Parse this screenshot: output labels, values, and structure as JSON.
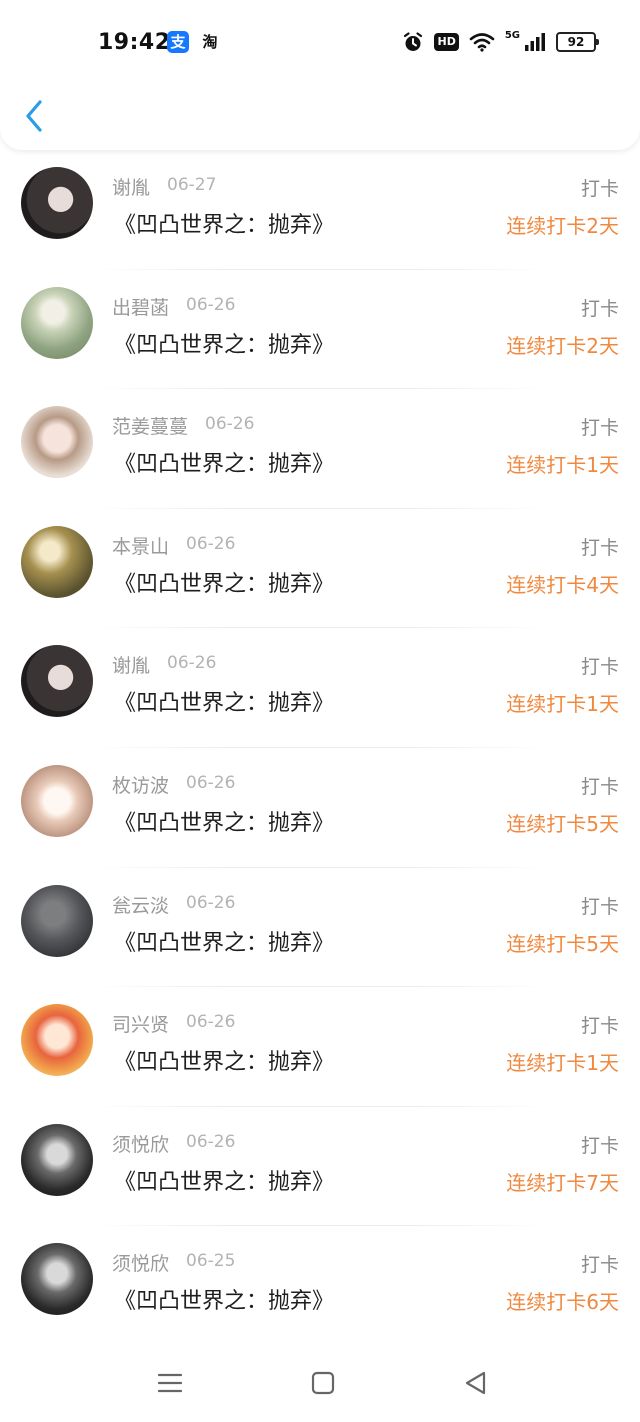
{
  "status_bar": {
    "time": "19:42",
    "app_icons": [
      {
        "name": "alipay-icon",
        "glyph": "支"
      },
      {
        "name": "taobao-icon",
        "glyph": "淘"
      }
    ],
    "hd": "HD",
    "network": "5G",
    "battery": "92"
  },
  "header": {
    "back_icon": "chevron-left-icon"
  },
  "colors": {
    "accent": "#2a9ce8",
    "streak": "#f0893f",
    "muted": "#9a9a9a"
  },
  "rows": [
    {
      "name": "谢胤",
      "date": "06-27",
      "title": "《凹凸世界之：抛弃》",
      "action": "打卡",
      "streak": "连续打卡2天",
      "avatar": "avatar-1"
    },
    {
      "name": "出碧菡",
      "date": "06-26",
      "title": "《凹凸世界之：抛弃》",
      "action": "打卡",
      "streak": "连续打卡2天",
      "avatar": "avatar-2"
    },
    {
      "name": "范姜蔓蔓",
      "date": "06-26",
      "title": "《凹凸世界之：抛弃》",
      "action": "打卡",
      "streak": "连续打卡1天",
      "avatar": "avatar-3"
    },
    {
      "name": "本景山",
      "date": "06-26",
      "title": "《凹凸世界之：抛弃》",
      "action": "打卡",
      "streak": "连续打卡4天",
      "avatar": "avatar-4"
    },
    {
      "name": "谢胤",
      "date": "06-26",
      "title": "《凹凸世界之：抛弃》",
      "action": "打卡",
      "streak": "连续打卡1天",
      "avatar": "avatar-1"
    },
    {
      "name": "枚访波",
      "date": "06-26",
      "title": "《凹凸世界之：抛弃》",
      "action": "打卡",
      "streak": "连续打卡5天",
      "avatar": "avatar-5"
    },
    {
      "name": "瓮云淡",
      "date": "06-26",
      "title": "《凹凸世界之：抛弃》",
      "action": "打卡",
      "streak": "连续打卡5天",
      "avatar": "avatar-6"
    },
    {
      "name": "司兴贤",
      "date": "06-26",
      "title": "《凹凸世界之：抛弃》",
      "action": "打卡",
      "streak": "连续打卡1天",
      "avatar": "avatar-7"
    },
    {
      "name": "须悦欣",
      "date": "06-26",
      "title": "《凹凸世界之：抛弃》",
      "action": "打卡",
      "streak": "连续打卡7天",
      "avatar": "avatar-8"
    },
    {
      "name": "须悦欣",
      "date": "06-25",
      "title": "《凹凸世界之：抛弃》",
      "action": "打卡",
      "streak": "连续打卡6天",
      "avatar": "avatar-8"
    }
  ],
  "nav_bar": {
    "items": [
      {
        "name": "menu-icon"
      },
      {
        "name": "home-icon"
      },
      {
        "name": "back-triangle-icon"
      }
    ]
  }
}
